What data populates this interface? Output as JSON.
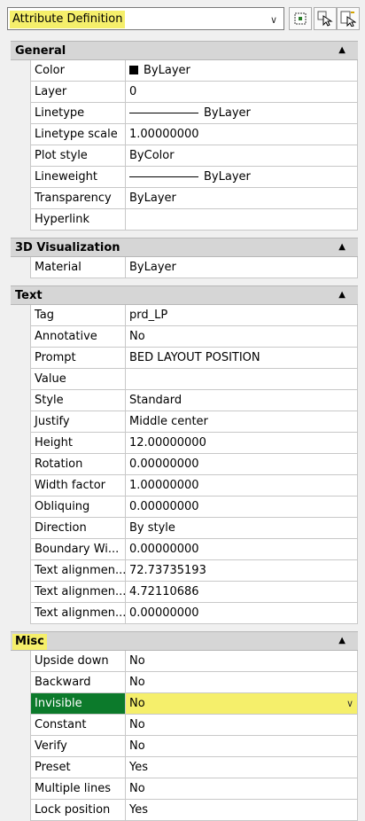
{
  "toolbar": {
    "object_type": "Attribute Definition",
    "dropdown_icon": "chevron-down-icon",
    "buttons": [
      "toggle-pickadd-icon",
      "select-objects-icon",
      "quick-select-icon"
    ]
  },
  "sections": [
    {
      "title": "General",
      "rows": [
        {
          "name": "Color",
          "value": "ByLayer",
          "swatch": true
        },
        {
          "name": "Layer",
          "value": "0"
        },
        {
          "name": "Linetype",
          "value": "ByLayer",
          "line": true
        },
        {
          "name": "Linetype scale",
          "value": "1.00000000"
        },
        {
          "name": "Plot style",
          "value": "ByColor"
        },
        {
          "name": "Lineweight",
          "value": "ByLayer",
          "line": true
        },
        {
          "name": "Transparency",
          "value": "ByLayer"
        },
        {
          "name": "Hyperlink",
          "value": ""
        }
      ]
    },
    {
      "title": "3D Visualization",
      "rows": [
        {
          "name": "Material",
          "value": "ByLayer"
        }
      ]
    },
    {
      "title": "Text",
      "rows": [
        {
          "name": "Tag",
          "value": "prd_LP"
        },
        {
          "name": "Annotative",
          "value": "No"
        },
        {
          "name": "Prompt",
          "value": "BED LAYOUT POSITION"
        },
        {
          "name": "Value",
          "value": ""
        },
        {
          "name": "Style",
          "value": "Standard"
        },
        {
          "name": "Justify",
          "value": "Middle center"
        },
        {
          "name": "Height",
          "value": "12.00000000"
        },
        {
          "name": "Rotation",
          "value": "0.00000000"
        },
        {
          "name": "Width factor",
          "value": "1.00000000"
        },
        {
          "name": "Obliquing",
          "value": "0.00000000"
        },
        {
          "name": "Direction",
          "value": "By style"
        },
        {
          "name": "Boundary Wi...",
          "value": "0.00000000"
        },
        {
          "name": "Text alignmen...",
          "value": "72.73735193"
        },
        {
          "name": "Text alignmen...",
          "value": "4.72110686"
        },
        {
          "name": "Text alignmen...",
          "value": "0.00000000"
        }
      ]
    },
    {
      "title": "Misc",
      "highlight": true,
      "rows": [
        {
          "name": "Upside down",
          "value": "No"
        },
        {
          "name": "Backward",
          "value": "No"
        },
        {
          "name": "Invisible",
          "value": "No",
          "selected": true
        },
        {
          "name": "Constant",
          "value": "No"
        },
        {
          "name": "Verify",
          "value": "No"
        },
        {
          "name": "Preset",
          "value": "Yes"
        },
        {
          "name": "Multiple lines",
          "value": "No"
        },
        {
          "name": "Lock position",
          "value": "Yes"
        }
      ]
    }
  ],
  "colors": {
    "highlight": "#f5ef6b",
    "selected_name_bg": "#0c7a2b"
  }
}
